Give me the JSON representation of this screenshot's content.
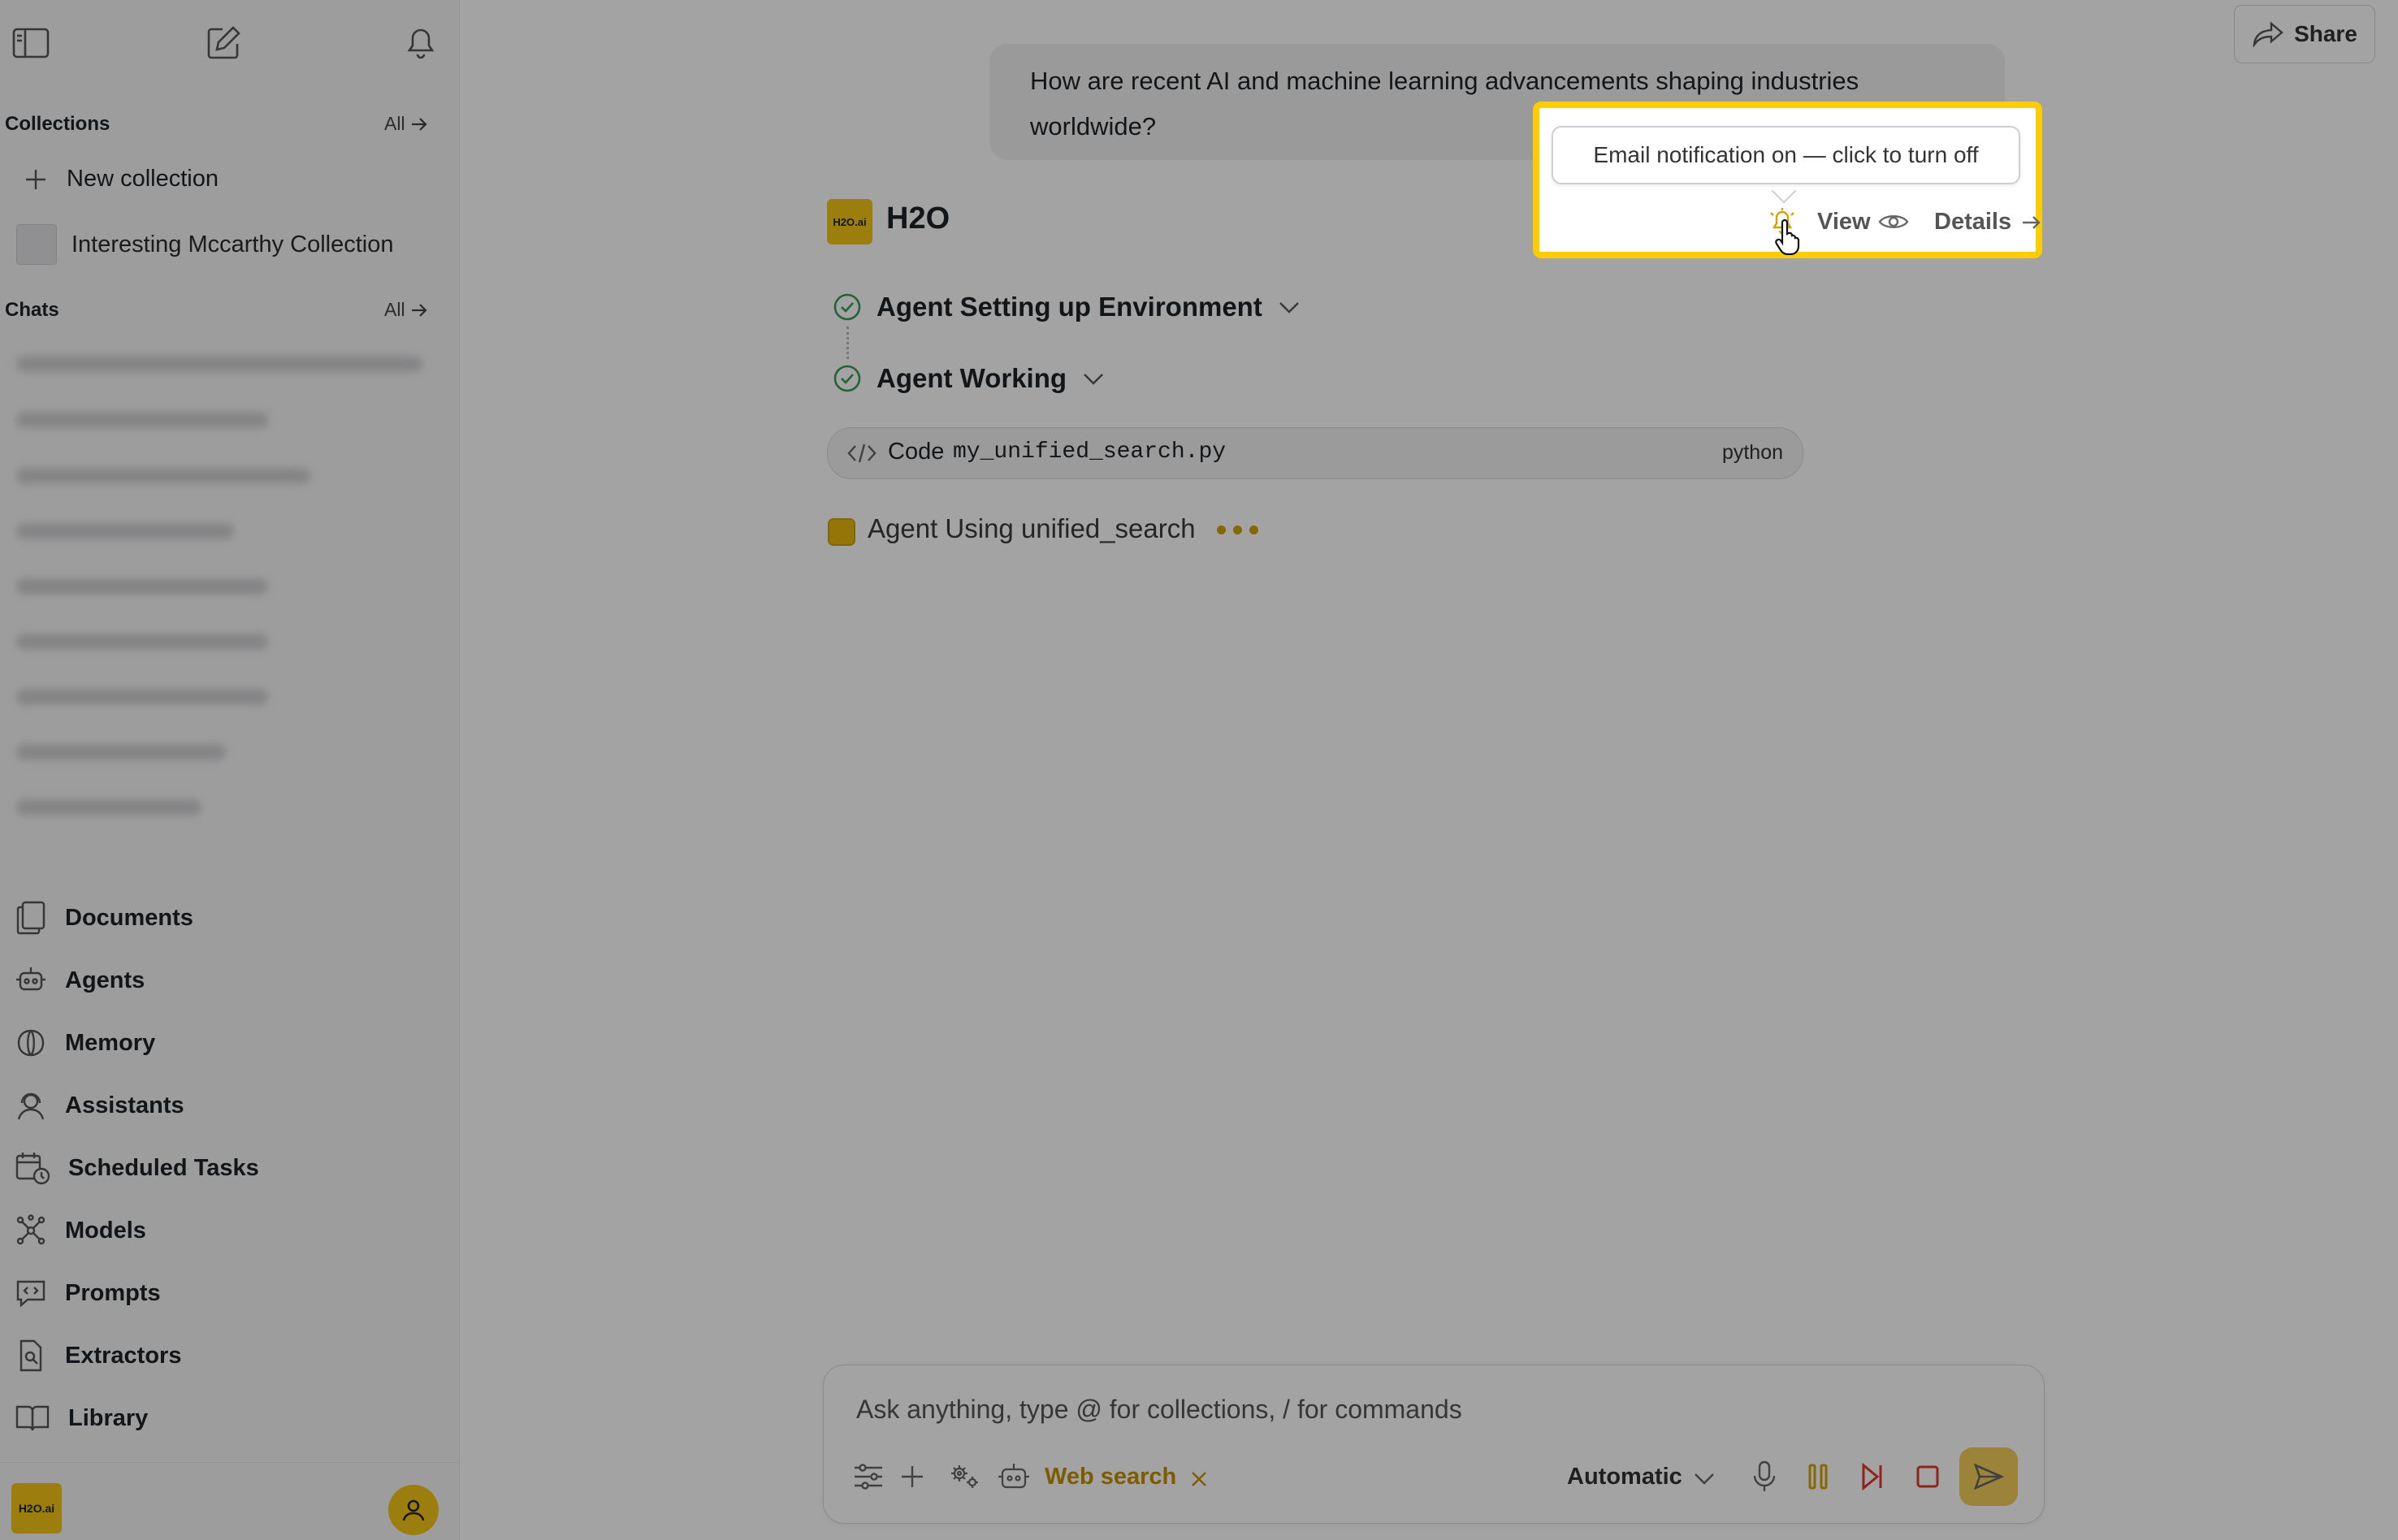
{
  "sidebar": {
    "collections_title": "Collections",
    "collections_all": "All",
    "new_collection": "New collection",
    "collection_item": "Interesting Mccarthy Collection",
    "chats_title": "Chats",
    "chats_all": "All",
    "nav": [
      {
        "label": "Documents",
        "icon": "documents-icon"
      },
      {
        "label": "Agents",
        "icon": "agents-icon"
      },
      {
        "label": "Memory",
        "icon": "memory-icon"
      },
      {
        "label": "Assistants",
        "icon": "assistants-icon"
      },
      {
        "label": "Scheduled Tasks",
        "icon": "scheduled-tasks-icon"
      },
      {
        "label": "Models",
        "icon": "models-icon"
      },
      {
        "label": "Prompts",
        "icon": "prompts-icon"
      },
      {
        "label": "Extractors",
        "icon": "extractors-icon"
      },
      {
        "label": "Library",
        "icon": "library-icon"
      }
    ],
    "footer_logo": "H2O.ai"
  },
  "header": {
    "share_label": "Share"
  },
  "conversation": {
    "user_message": "How are recent AI and machine learning advancements shaping industries worldwide?",
    "assistant_name": "H2O",
    "assistant_logo": "H2O.ai",
    "steps": [
      {
        "label": "Agent Setting up Environment",
        "status": "done"
      },
      {
        "label": "Agent Working",
        "status": "done"
      }
    ],
    "code": {
      "prefix": "Code",
      "filename": "my_unified_search.py",
      "language": "python"
    },
    "running": {
      "label": "Agent Using unified_search"
    },
    "actions": {
      "view_label": "View",
      "details_label": "Details"
    },
    "tooltip": "Email notification on — click to turn off"
  },
  "composer": {
    "placeholder": "Ask anything, type @ for collections, / for commands",
    "web_search_label": "Web search",
    "model_label": "Automatic"
  },
  "colors": {
    "accent": "#d4a106",
    "highlight": "#ffcc00",
    "success": "#3a9a55",
    "stop": "#e0392b"
  }
}
